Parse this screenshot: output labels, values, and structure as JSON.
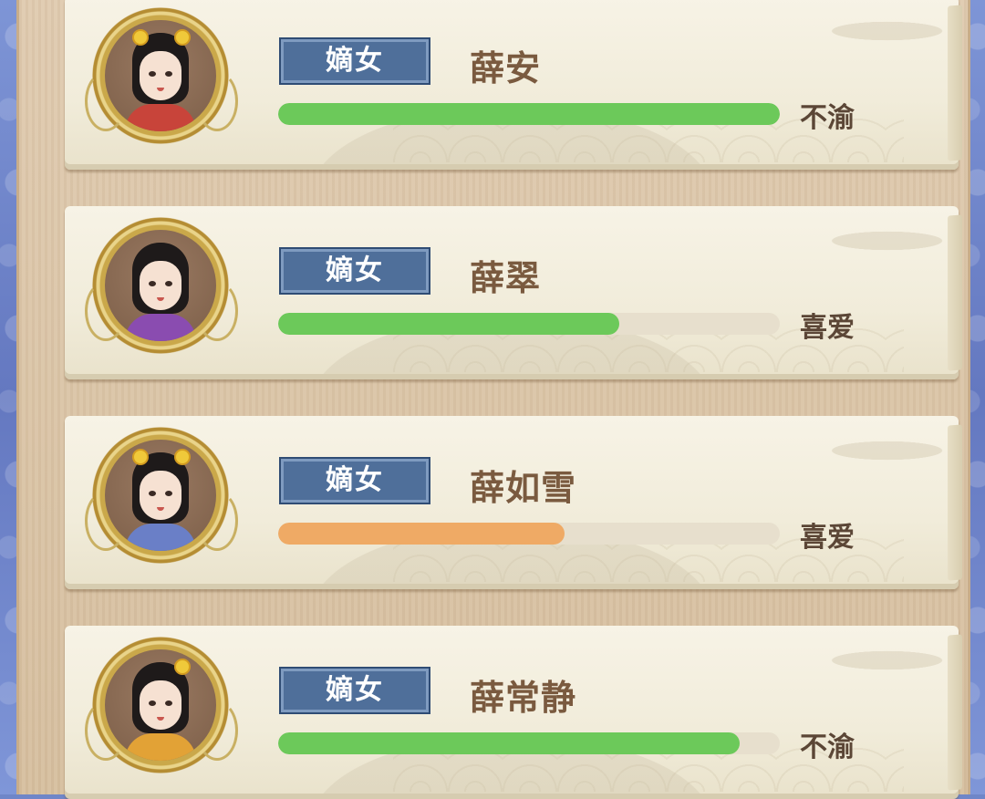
{
  "colors": {
    "bar_green": "#6cc95a",
    "bar_orange": "#efaa65",
    "badge_blue": "#4f6f9a",
    "name_brown": "#7a5a3f"
  },
  "characters": [
    {
      "rank": "嫡女",
      "name": "薛安",
      "mood": "不渝",
      "affection": 1.0,
      "bar_color": "#6cc95a",
      "robe_color": "#c8443a",
      "avatar_icon": "portrait-icon"
    },
    {
      "rank": "嫡女",
      "name": "薛翠",
      "mood": "喜爱",
      "affection": 0.68,
      "bar_color": "#6cc95a",
      "robe_color": "#8a4cb0",
      "avatar_icon": "portrait-icon"
    },
    {
      "rank": "嫡女",
      "name": "薛如雪",
      "mood": "喜爱",
      "affection": 0.57,
      "bar_color": "#efaa65",
      "robe_color": "#6a7fc7",
      "avatar_icon": "portrait-icon"
    },
    {
      "rank": "嫡女",
      "name": "薛常静",
      "mood": "不渝",
      "affection": 0.92,
      "bar_color": "#6cc95a",
      "robe_color": "#e2a236",
      "avatar_icon": "portrait-icon"
    }
  ]
}
